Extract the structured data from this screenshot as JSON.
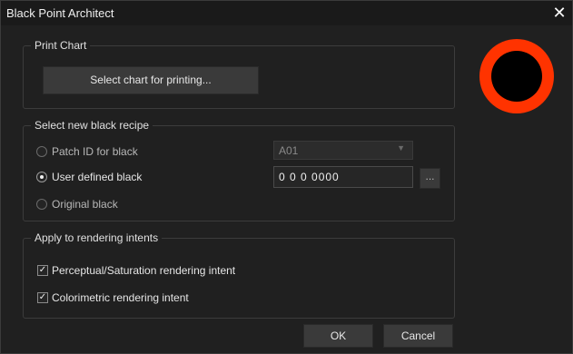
{
  "window": {
    "title": "Black Point Architect",
    "close_glyph": "✕"
  },
  "print_chart": {
    "legend": "Print Chart",
    "select_button_label": "Select chart for printing..."
  },
  "black_recipe": {
    "legend": "Select new black recipe",
    "options": [
      {
        "label": "Patch ID for black",
        "selected": false
      },
      {
        "label": "User defined black",
        "selected": true
      },
      {
        "label": "Original black",
        "selected": false
      }
    ],
    "patch_id_value": "A01",
    "user_defined_value": "0 0 0 0000",
    "browse_label": "..."
  },
  "rendering_intents": {
    "legend": "Apply to rendering intents",
    "items": [
      {
        "label": "Perceptual/Saturation rendering intent",
        "checked": true
      },
      {
        "label": "Colorimetric rendering intent",
        "checked": true
      }
    ]
  },
  "footer": {
    "ok_label": "OK",
    "cancel_label": "Cancel"
  },
  "colors": {
    "background": "#202020",
    "swatch_ring": "#ff3300",
    "swatch_center": "#000000"
  },
  "icons": {
    "close": "close-icon",
    "dropdown": "chevron-down-icon",
    "check": "check-icon"
  }
}
